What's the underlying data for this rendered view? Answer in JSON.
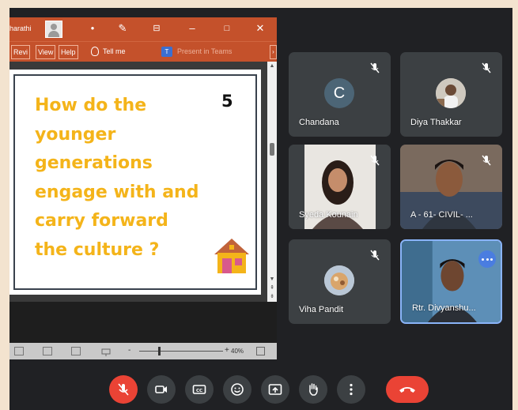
{
  "powerpoint": {
    "title_user": "harathi",
    "ribbon_tabs": [
      "Revi",
      "View",
      "Help"
    ],
    "tell_me": "Tell me",
    "present_in_teams": "Present in Teams",
    "slide": {
      "text": "How do the\nyounger\ngenerations\nengage with and\ncarry forward\nthe culture ?",
      "number": "5",
      "text_color": "#f4b41a"
    },
    "status_bar": {
      "zoom_minus": "-",
      "zoom_plus": "+",
      "zoom": "40%"
    }
  },
  "participants": [
    {
      "name": "Chandana",
      "initial": "C",
      "muted": true,
      "type": "initial"
    },
    {
      "name": "Diya Thakkar",
      "muted": true,
      "type": "photo-avatar"
    },
    {
      "name": "Syeda Kounain",
      "muted": true,
      "type": "video"
    },
    {
      "name": "A - 61- CIVIL- ...",
      "muted": true,
      "type": "video"
    },
    {
      "name": "Viha Pandit",
      "muted": true,
      "type": "photo-avatar"
    },
    {
      "name": "Rtr. Divyanshu...",
      "muted": false,
      "type": "video",
      "active_speaker": true
    }
  ],
  "controls": {
    "buttons": [
      "mic-off",
      "camera",
      "captions",
      "emoji",
      "present",
      "raise-hand",
      "more-options",
      "leave-call"
    ],
    "accent_red": "#ea4335",
    "button_grey": "#3c4043"
  },
  "colors": {
    "ppt_orange": "#c4512b",
    "meet_background": "#202124",
    "active_speaker_border": "#8ab4f8"
  }
}
